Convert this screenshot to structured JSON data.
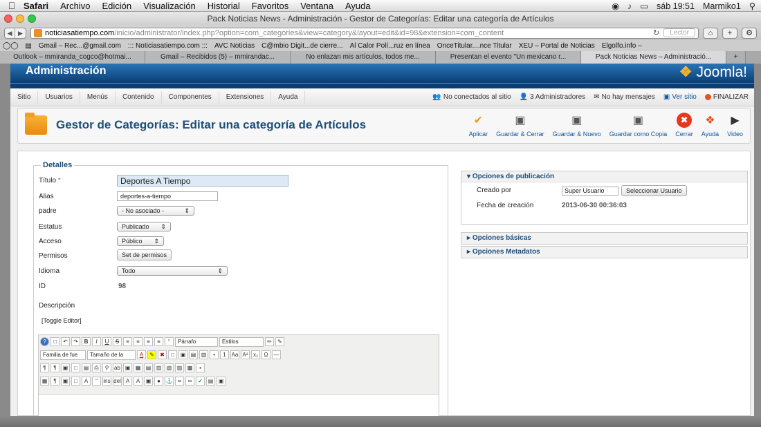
{
  "macmenu": {
    "app": "Safari",
    "items": [
      "Archivo",
      "Edición",
      "Visualización",
      "Historial",
      "Favoritos",
      "Ventana",
      "Ayuda"
    ],
    "clock": "sáb 19:51",
    "user": "Marmiko1"
  },
  "window": {
    "title": "Pack Noticias News - Administración - Gestor de Categorías: Editar una categoría de Artículos"
  },
  "address": {
    "host": "noticiasatiempo.com",
    "path": "/inicio/administrator/index.php?option=com_categories&view=category&layout=edit&id=98&extension=com_content",
    "reader": "Lector"
  },
  "bookmarks": [
    "Gmail – Rec...@gmail.com",
    "::: Noticiasatiempo.com :::",
    "AVC Noticias",
    "C@mbio Digit...de cierre...",
    "Al Calor Polí...ruz en línea",
    "OnceTitular....nce Titular",
    "XEU – Portal de Noticias",
    "Elgolfo.info –"
  ],
  "tabs": [
    "Outlook – mmiranda_cogco@hotmai...",
    "Gmail – Recibidos (5) – mmirandac...",
    "No enlazan mis artículos, todos me...",
    "Presentan el evento \"Un mexicano r...",
    "Pack Noticias News – Administració..."
  ],
  "joomla": {
    "admin": "Administración",
    "logo": "Joomla!",
    "menu": [
      "Sitio",
      "Usuarios",
      "Menús",
      "Contenido",
      "Componentes",
      "Extensiones",
      "Ayuda"
    ],
    "status": {
      "offline": "No conectados al sitio",
      "admins": "3 Administradores",
      "messages": "No hay mensajes",
      "view": "Ver sitio",
      "logout": "FINALIZAR"
    }
  },
  "toolbar": {
    "title": "Gestor de Categorías: Editar una categoría de Artículos",
    "buttons": [
      "Aplicar",
      "Guardar & Cerrar",
      "Guardar & Nuevo",
      "Guardar como Copia",
      "Cerrar",
      "Ayuda",
      "Video"
    ]
  },
  "details": {
    "legend": "Detalles",
    "labels": {
      "title": "Título",
      "alias": "Alias",
      "parent": "padre",
      "status": "Estatus",
      "access": "Acceso",
      "perms": "Permisos",
      "lang": "Idioma",
      "id": "ID",
      "desc": "Descripción",
      "toggle": "[Toggle Editor]"
    },
    "values": {
      "title": "Deportes A Tiempo",
      "alias": "deportes-a-tiempo",
      "parent": "- No asociado -",
      "status": "Publicado",
      "access": "Público",
      "perms": "Set de permisos",
      "lang": "Todo",
      "id": "98"
    }
  },
  "editor": {
    "format": "Párrafo",
    "styles": "Estilos",
    "font": "Familia de fue",
    "size": "Tamaño de la"
  },
  "publish": {
    "header": "Opciones de publicación",
    "created_by_label": "Creado por",
    "created_by": "Super Usuario",
    "select_user": "Seleccionar Usuario",
    "created_label": "Fecha de creación",
    "created": "2013-06-30 00:36:03"
  },
  "basic": "Opciones básicas",
  "meta": "Opciones Metadatos"
}
